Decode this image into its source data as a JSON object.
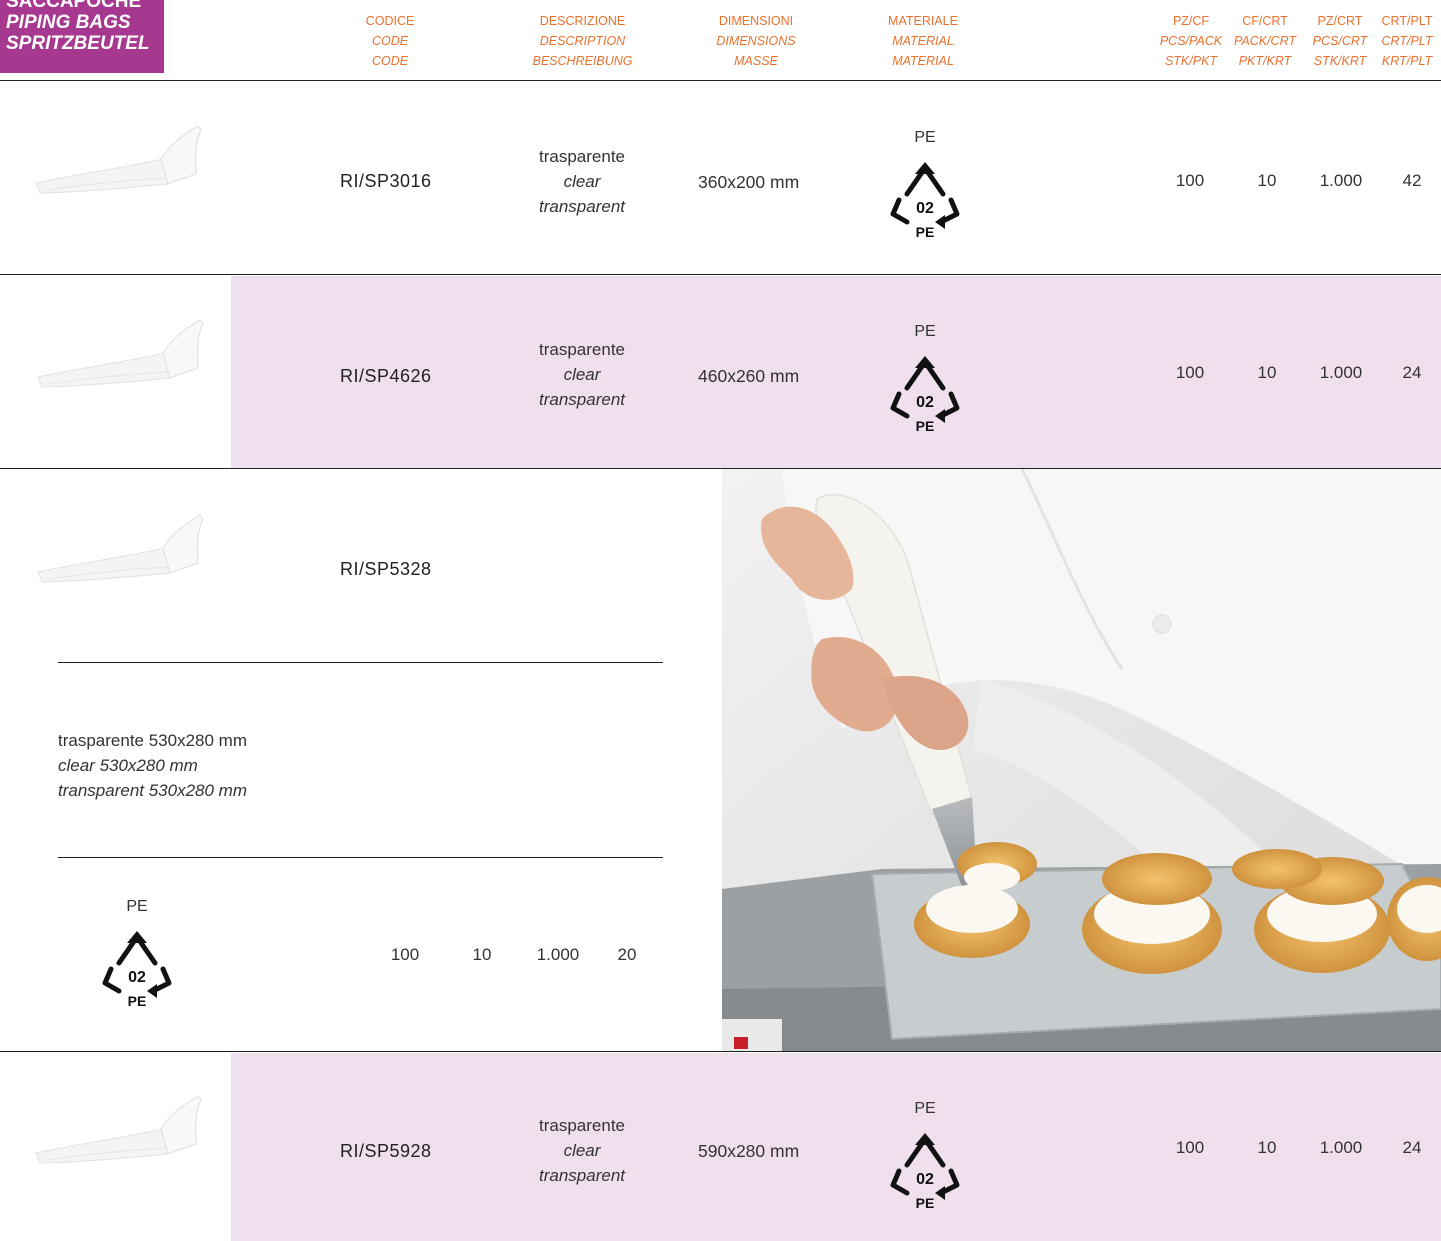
{
  "category": {
    "lines": [
      "SACCAPOCHE",
      "PIPING BAGS",
      "SPRITZBEUTEL"
    ]
  },
  "header": {
    "codice": [
      "CODICE",
      "CODE",
      "CODE"
    ],
    "descrizione": [
      "DESCRIZIONE",
      "DESCRIPTION",
      "BESCHREIBUNG"
    ],
    "dimensioni": [
      "DIMENSIONI",
      "DIMENSIONS",
      "MASSE"
    ],
    "materiale": [
      "MATERIALE",
      "MATERIAL",
      "MATERIAL"
    ],
    "pzcf": [
      "PZ/CF",
      "PCS/PACK",
      "STK/PKT"
    ],
    "cfcrt": [
      "CF/CRT",
      "PACK/CRT",
      "PKT/KRT"
    ],
    "pzcrt": [
      "PZ/CRT",
      "PCS/CRT",
      "STK/KRT"
    ],
    "crtplt": [
      "CRT/PLT",
      "CRT/PLT",
      "KRT/PLT"
    ]
  },
  "colors": {
    "accent": "#a6388f",
    "header_text": "#e8712e",
    "row_tint": "#f0e0ee"
  },
  "recycle": {
    "number": "02",
    "code": "PE"
  },
  "products": [
    {
      "code": "RI/SP3016",
      "desc": [
        "trasparente",
        "clear",
        "transparent"
      ],
      "dim": "360x200 mm",
      "material": "PE",
      "pz_cf": "100",
      "cf_crt": "10",
      "pz_crt": "1.000",
      "crt_plt": "42"
    },
    {
      "code": "RI/SP4626",
      "desc": [
        "trasparente",
        "clear",
        "transparent"
      ],
      "dim": "460x260 mm",
      "material": "PE",
      "pz_cf": "100",
      "cf_crt": "10",
      "pz_crt": "1.000",
      "crt_plt": "24"
    },
    {
      "code": "RI/SP5328",
      "desc": [
        "trasparente 530x280 mm",
        "clear 530x280 mm",
        "transparent 530x280 mm"
      ],
      "material": "PE",
      "pz_cf": "100",
      "cf_crt": "10",
      "pz_crt": "1.000",
      "crt_plt": "20"
    },
    {
      "code": "RI/SP5928",
      "desc": [
        "trasparente",
        "clear",
        "transparent"
      ],
      "dim": "590x280 mm",
      "material": "PE",
      "pz_cf": "100",
      "cf_crt": "10",
      "pz_crt": "1.000",
      "crt_plt": "24"
    }
  ]
}
